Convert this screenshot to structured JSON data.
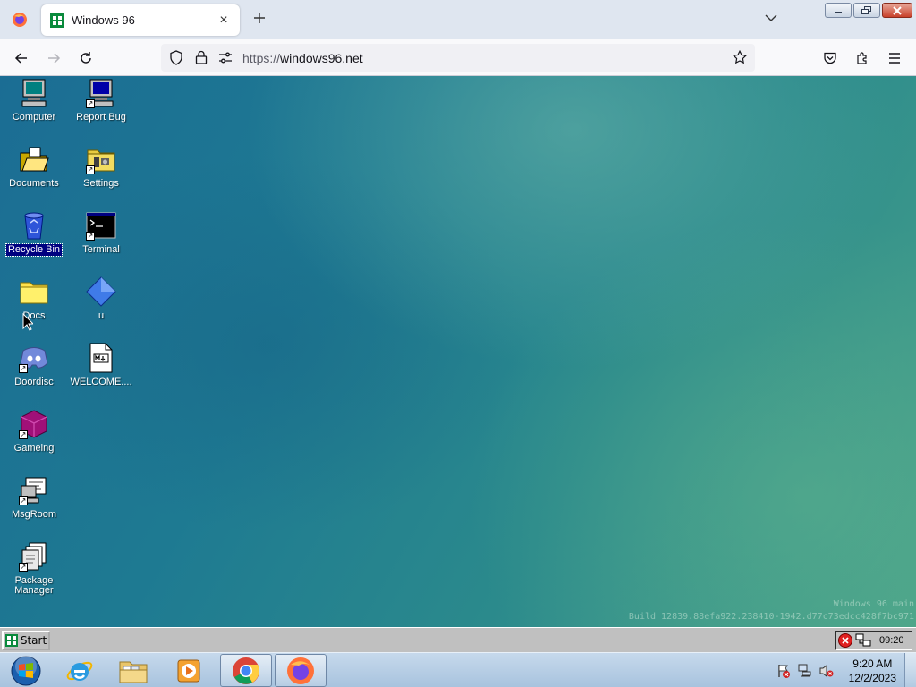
{
  "browser": {
    "tab": {
      "title": "Windows 96",
      "close_icon": "close-icon"
    },
    "new_tab_icon": "plus-icon",
    "address": {
      "scheme": "https://",
      "host": "windows96.net"
    },
    "window_controls": [
      "minimize",
      "restore",
      "close"
    ]
  },
  "desktop": {
    "icons": [
      {
        "label": "Computer",
        "icon": "computer-icon",
        "shortcut": false,
        "selected": false
      },
      {
        "label": "Report Bug",
        "icon": "computer-icon",
        "shortcut": true,
        "selected": false
      },
      {
        "label": "Documents",
        "icon": "open-folder-icon",
        "shortcut": false,
        "selected": false
      },
      {
        "label": "Settings",
        "icon": "settings-folder-icon",
        "shortcut": true,
        "selected": false
      },
      {
        "label": "Recycle Bin",
        "icon": "recycle-bin-icon",
        "shortcut": false,
        "selected": true
      },
      {
        "label": "Terminal",
        "icon": "terminal-icon",
        "shortcut": true,
        "selected": false
      },
      {
        "label": "Docs",
        "icon": "folder-icon",
        "shortcut": false,
        "selected": false
      },
      {
        "label": "u",
        "icon": "blue-diamond-icon",
        "shortcut": false,
        "selected": false
      },
      {
        "label": "Doordisc",
        "icon": "discord-icon",
        "shortcut": true,
        "selected": false
      },
      {
        "label": "WELCOME....",
        "icon": "markdown-file-icon",
        "shortcut": false,
        "selected": false
      },
      {
        "label": "Gameing",
        "icon": "cube-icon",
        "shortcut": true,
        "selected": false
      },
      {
        "label": "MsgRoom",
        "icon": "chat-computer-icon",
        "shortcut": true,
        "selected": false
      },
      {
        "label": "Package Manager",
        "icon": "package-icon",
        "shortcut": true,
        "selected": false
      }
    ],
    "build_line1": "Windows 96 main",
    "build_line2": "Build 12839.88efa922.238410-1942.d77c73edcc428f7bc971"
  },
  "w96_taskbar": {
    "start_label": "Start",
    "clock": "09:20"
  },
  "w7_taskbar": {
    "pinned": [
      "windows-orb-icon",
      "internet-explorer-icon",
      "file-explorer-icon",
      "media-player-icon",
      "chrome-icon",
      "firefox-icon"
    ],
    "clock_time": "9:20 AM",
    "clock_date": "12/2/2023"
  },
  "colors": {
    "desktop_teal": "#1e7a92",
    "win96_gray": "#c0c0c0",
    "selection_navy": "#000080"
  }
}
